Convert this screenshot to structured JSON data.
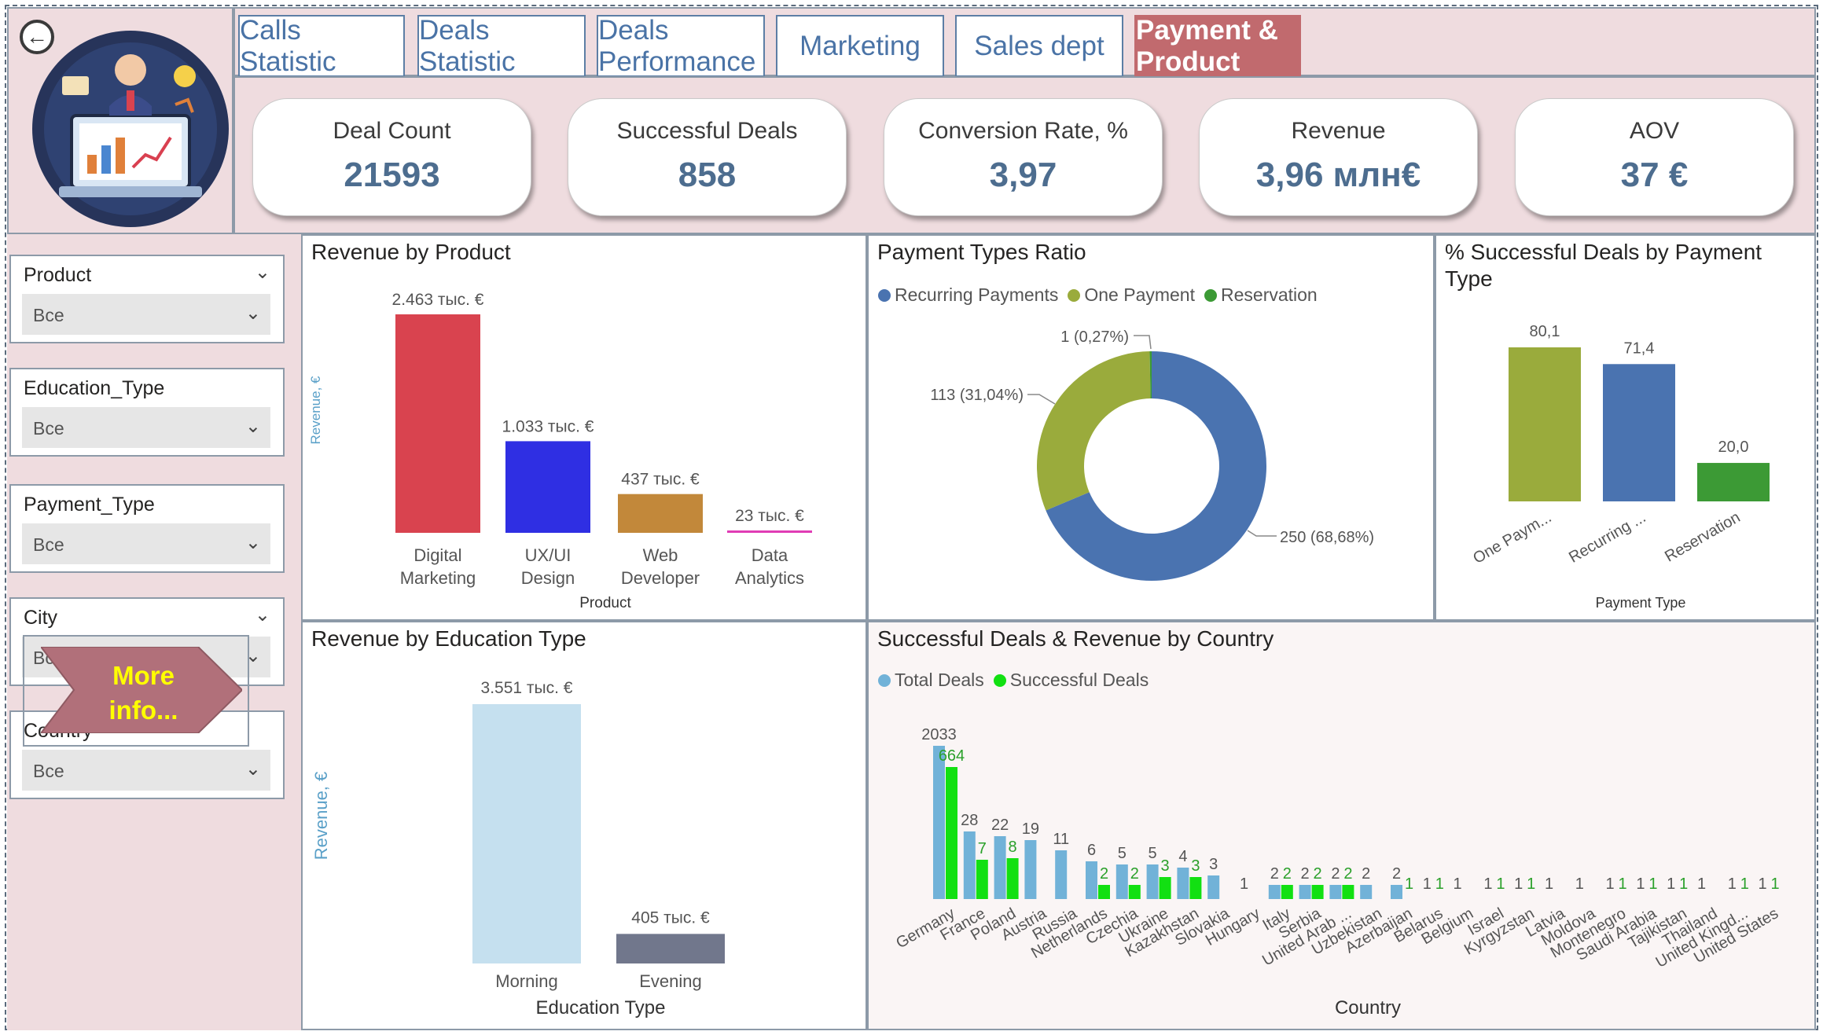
{
  "tabs": [
    {
      "label": "Calls Statistic",
      "active": false
    },
    {
      "label": "Deals Statistic",
      "active": false
    },
    {
      "label": "Deals Performance",
      "active": false
    },
    {
      "label": "Marketing",
      "active": false
    },
    {
      "label": "Sales dept",
      "active": false
    },
    {
      "label": "Payment & Product",
      "active": true
    }
  ],
  "kpis": [
    {
      "label": "Deal Count",
      "value": "21593"
    },
    {
      "label": "Successful Deals",
      "value": "858"
    },
    {
      "label": "Conversion Rate, %",
      "value": "3,97"
    },
    {
      "label": "Revenue",
      "value": "3,96 млн€"
    },
    {
      "label": "AOV",
      "value": "37 €"
    }
  ],
  "slicers": [
    {
      "title": "Product",
      "value": "Все"
    },
    {
      "title": "Education_Type",
      "value": "Все"
    },
    {
      "title": "Payment_Type",
      "value": "Все"
    },
    {
      "title": "City",
      "value": "Все"
    },
    {
      "title": "Country",
      "value": "Все"
    }
  ],
  "more_button": {
    "line1": "More",
    "line2": "info..."
  },
  "icons": {
    "back": "back-arrow-icon",
    "logo": "analytics-illustration-icon"
  },
  "colors": {
    "accent_tab": "#c16a6e",
    "band": "#efdcdf",
    "kpi_value": "#4d6d8f"
  },
  "chart_data": [
    {
      "id": "revenue_by_product",
      "type": "bar",
      "title": "Revenue by Product",
      "xlabel": "Product",
      "ylabel": "Revenue, €",
      "categories": [
        "Digital Marketing",
        "UX/UI Design",
        "Web Developer",
        "Data Analytics"
      ],
      "category_lines": [
        [
          "Digital",
          "Marketing"
        ],
        [
          "UX/UI",
          "Design"
        ],
        [
          "Web",
          "Developer"
        ],
        [
          "Data",
          "Analytics"
        ]
      ],
      "values": [
        2463,
        1033,
        437,
        23
      ],
      "value_labels": [
        "2.463 тыс. €",
        "1.033 тыс. €",
        "437 тыс. €",
        "23 тыс. €"
      ],
      "colors": [
        "#d9434f",
        "#2f2fe3",
        "#c2883a",
        "#e03cb5"
      ],
      "ylim": [
        0,
        2463
      ]
    },
    {
      "id": "payment_types_ratio",
      "type": "pie",
      "title": "Payment Types Ratio",
      "legend": [
        "Recurring Payments",
        "One Payment",
        "Reservation"
      ],
      "colors": [
        "#4a73b0",
        "#9aab3c",
        "#3c9a35"
      ],
      "values": [
        250,
        113,
        1
      ],
      "labels": [
        "250 (68,68%)",
        "113 (31,04%)",
        "1 (0,27%)"
      ]
    },
    {
      "id": "pct_successful_by_payment",
      "type": "bar",
      "title": "% Successful Deals by Payment Type",
      "xlabel": "Payment Type",
      "categories": [
        "One Paym...",
        "Recurring ...",
        "Reservation"
      ],
      "values": [
        80.1,
        71.4,
        20.0
      ],
      "value_labels": [
        "80,1",
        "71,4",
        "20,0"
      ],
      "colors": [
        "#9aab3c",
        "#4a73b0",
        "#3c9a35"
      ]
    },
    {
      "id": "revenue_by_education",
      "type": "bar",
      "title": "Revenue by Education Type",
      "xlabel": "Education Type",
      "ylabel": "Revenue, €",
      "categories": [
        "Morning",
        "Evening"
      ],
      "values": [
        3551,
        405
      ],
      "value_labels": [
        "3.551 тыс. €",
        "405 тыс. €"
      ],
      "colors": [
        "#c5e0ef",
        "#71778c"
      ]
    },
    {
      "id": "deals_by_country",
      "type": "bar",
      "title": "Successful Deals & Revenue by Country",
      "xlabel": "Country",
      "legend_position": "top-left",
      "categories": [
        "Germany",
        "France",
        "Poland",
        "Austria",
        "Russia",
        "Netherlands",
        "Czechia",
        "Ukraine",
        "Kazakhstan",
        "Slovakia",
        "Hungary",
        "Italy",
        "Serbia",
        "United Arab ...",
        "Uzbekistan",
        "Azerbaijan",
        "Belarus",
        "Belgium",
        "Israel",
        "Kyrgyzstan",
        "Latvia",
        "Moldova",
        "Montenegro",
        "Saudi Arabia",
        "Tajikistan",
        "Thailand",
        "United Kingd...",
        "United States"
      ],
      "series": [
        {
          "name": "Total Deals",
          "color": "#71b2d8",
          "values": [
            2033,
            28,
            22,
            19,
            11,
            6,
            5,
            5,
            4,
            3,
            1,
            2,
            2,
            2,
            2,
            2,
            1,
            1,
            1,
            1,
            1,
            1,
            1,
            1,
            1,
            1,
            1,
            1
          ],
          "labels": [
            "2033",
            "28",
            "22",
            "19",
            "11",
            "6",
            "5",
            "5",
            "4",
            "3",
            "1",
            "2",
            "2",
            "2",
            "2",
            "2",
            "1",
            "1",
            "1",
            "1",
            "1",
            "1",
            "1",
            "1",
            "1",
            "1",
            "1",
            "1"
          ]
        },
        {
          "name": "Successful Deals",
          "color": "#12e012",
          "values": [
            664,
            7,
            8,
            null,
            null,
            2,
            2,
            3,
            3,
            null,
            null,
            2,
            2,
            2,
            null,
            1,
            1,
            null,
            1,
            1,
            null,
            null,
            1,
            1,
            1,
            null,
            1,
            1
          ],
          "labels": [
            "664",
            "7",
            "8",
            "",
            "",
            "2",
            "2",
            "3",
            "3",
            "",
            "",
            "2",
            "2",
            "2",
            "",
            "1",
            "1",
            "",
            "1",
            "1",
            "",
            "",
            "1",
            "1",
            "1",
            "",
            "1",
            "1"
          ]
        }
      ]
    }
  ]
}
